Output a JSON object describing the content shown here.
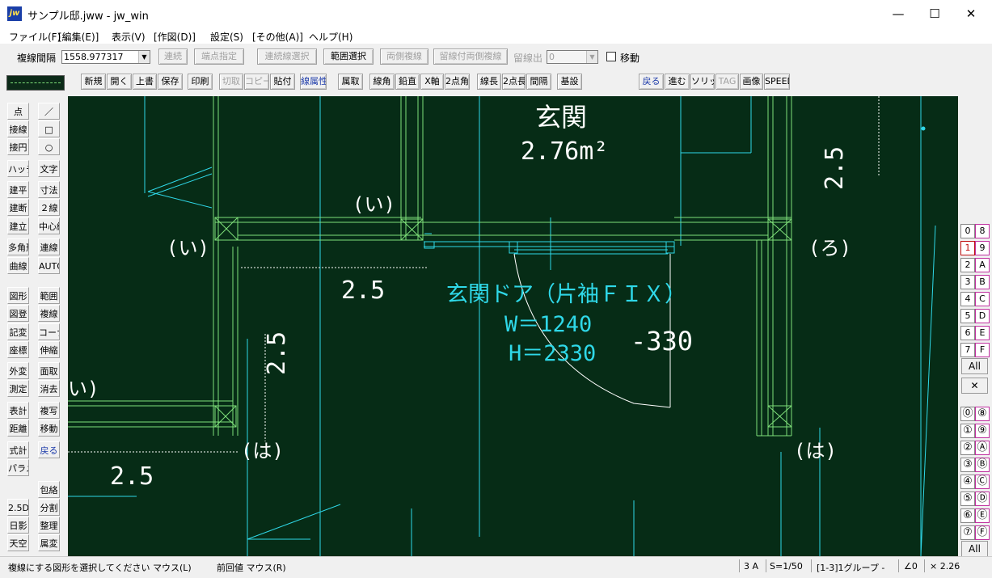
{
  "window": {
    "title": "サンプル邸.jww - jw_win",
    "icon_label": "jw",
    "minimize": "—",
    "maximize": "☐",
    "close": "✕"
  },
  "menu": [
    "ファイル(F)",
    "[編集(E)]",
    "表示(V)",
    "[作図(D)]",
    "設定(S)",
    "[その他(A)]",
    "ヘルプ(H)"
  ],
  "toolbar1": {
    "spacing_label": "複線間隔",
    "spacing_value": "1558.977317",
    "buttons": [
      "連続",
      "端点指定",
      "連続線選択",
      "範囲選択",
      "両側複線",
      "留線付両側複線",
      "留線出"
    ],
    "留線出_value": "0",
    "move_label": "移動"
  },
  "toolbar2": {
    "buttons": [
      "新規",
      "開く",
      "上書",
      "保存",
      "印刷",
      "切取",
      "コピー",
      "貼付",
      "線属性",
      "属取",
      "線角",
      "鉛直",
      "X軸",
      "2点角",
      "線長",
      "2点長",
      "間隔",
      "基設",
      "戻る",
      "進む",
      "ソリッド",
      "TAG",
      "画像",
      "SPEED"
    ]
  },
  "left_tools": [
    [
      "点",
      "／"
    ],
    [
      "接線",
      "□"
    ],
    [
      "接円",
      "○"
    ],
    [
      "ハッチ",
      "文字"
    ],
    [
      "建平",
      "寸法"
    ],
    [
      "建断",
      "２線"
    ],
    [
      "建立",
      "中心線"
    ],
    [
      "多角形",
      "連線"
    ],
    [
      "曲線",
      "AUTO"
    ],
    [
      "図形",
      "範囲"
    ],
    [
      "図登",
      "複線"
    ],
    [
      "記変",
      "コーナー"
    ],
    [
      "座標",
      "伸縮"
    ],
    [
      "外変",
      "面取"
    ],
    [
      "測定",
      "消去"
    ],
    [
      "表計",
      "複写"
    ],
    [
      "距離",
      "移動"
    ],
    [
      "式計",
      "戻る"
    ],
    [
      "パラメ",
      ""
    ],
    [
      "",
      "包絡"
    ],
    [
      "2.5D",
      "分割"
    ],
    [
      "日影",
      "整理"
    ],
    [
      "天空",
      "属変"
    ]
  ],
  "right_layers": {
    "groups_top": [
      [
        "0",
        "8"
      ],
      [
        "1",
        "9"
      ],
      [
        "2",
        "A"
      ],
      [
        "3",
        "B"
      ],
      [
        "4",
        "C"
      ],
      [
        "5",
        "D"
      ],
      [
        "6",
        "E"
      ],
      [
        "7",
        "F"
      ]
    ],
    "all_label": "All",
    "x_label": "✕",
    "groups_bottom": [
      [
        "⓪",
        "⑧"
      ],
      [
        "①",
        "⑨"
      ],
      [
        "②",
        "Ⓐ"
      ],
      [
        "③",
        "Ⓑ"
      ],
      [
        "④",
        "Ⓒ"
      ],
      [
        "⑤",
        "Ⓓ"
      ],
      [
        "⑥",
        "Ⓔ"
      ],
      [
        "⑦",
        "Ⓕ"
      ]
    ],
    "all_bottom_label": "All"
  },
  "drawing": {
    "room_name": "玄関",
    "room_area": "2.76m²",
    "door_title": "玄関ドア（片袖ＦＩＸ）",
    "door_w": "W＝1240",
    "door_h": "H＝2330",
    "door_offset": "-330",
    "labels": {
      "i_top": "(い)",
      "i_left": "(い)",
      "i_edge": "い)",
      "ro": "(ろ)",
      "ha_left": "(は)",
      "ha_right": "(は)",
      "dim_25_center": "2.5",
      "dim_25_vertical": "2.5",
      "dim_25_bottom": "2.5",
      "dim_25_right": "2.5"
    },
    "colors": {
      "background": "#062c16",
      "wall": "#7fe07a",
      "cyan": "#2fd8e8",
      "white": "#ffffff"
    }
  },
  "status": {
    "message": "複線にする図形を選択してください マウス(L)",
    "prev_value": "前回値 マウス(R)",
    "paper": "3 A",
    "scale": "S=1/50",
    "layer": "[1-3]1グループ -",
    "angle": "∠0",
    "zoom": "× 2.26"
  }
}
